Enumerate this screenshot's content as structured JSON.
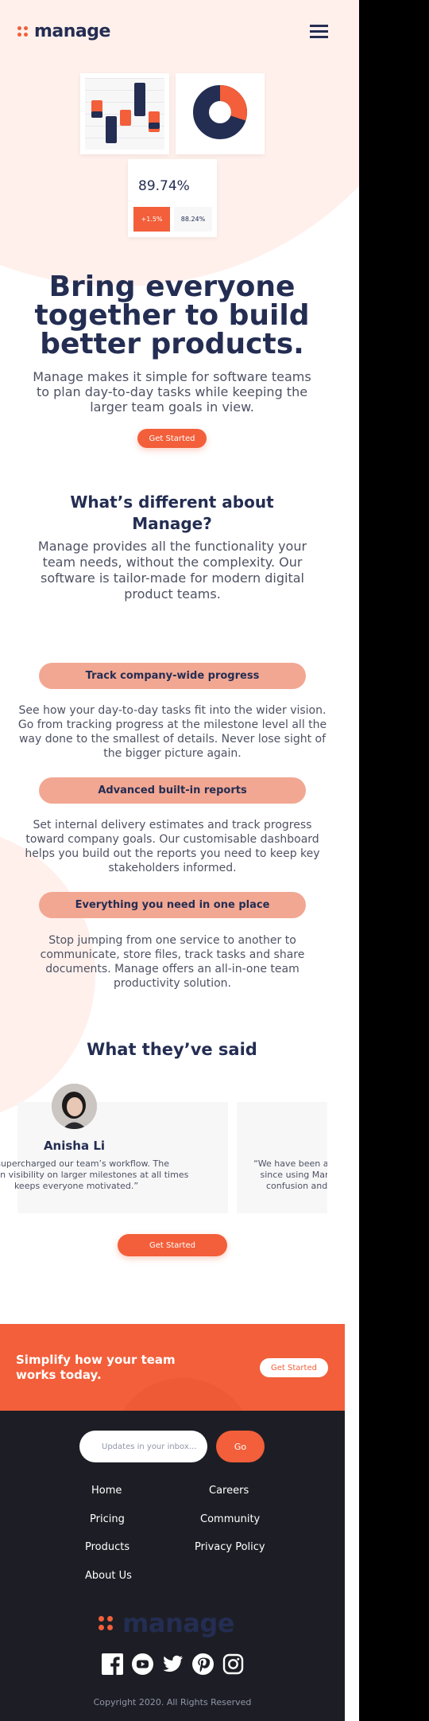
{
  "colors": {
    "accent": "#F25F3A",
    "navy": "#242D52",
    "pill": "#F2A793",
    "footer": "#1D1E25",
    "tint": "#FFF0EC"
  },
  "header": {
    "logo_text": "manage",
    "menu_icon": "hamburger-icon"
  },
  "illustration": {
    "bars": [
      {
        "color": "#F25F3A"
      },
      {
        "color": "#242D52"
      },
      {
        "color": "#F25F3A"
      },
      {
        "color": "#242D52"
      },
      {
        "color": "#F25F3A"
      }
    ],
    "donut": {
      "orange_fraction": 0.3
    },
    "stat_main": "89.74%",
    "stat_delta": "+1.5%",
    "stat_secondary": "88.24%"
  },
  "hero": {
    "title": "Bring everyone together to build better products.",
    "text": "Manage makes it simple for software teams to plan day-to-day tasks while keeping the larger team goals in view.",
    "cta_label": "Get Started"
  },
  "different": {
    "title": "What’s different about Manage?",
    "text": "Manage provides all the functionality your team needs, without the complexity. Our software is tailor-made for modern digital product teams."
  },
  "features": [
    {
      "title": "Track company-wide progress",
      "text": "See how your day-to-day tasks fit into the wider vision. Go from tracking progress at the milestone level all the way done to the smallest of details. Never lose sight of the bigger picture again."
    },
    {
      "title": "Advanced built-in reports",
      "text": "Set internal delivery estimates and track progress toward company goals. Our customisable dashboard helps you build out the reports you need to keep key stakeholders informed."
    },
    {
      "title": "Everything you need in one place",
      "text": "Stop jumping from one service to another to communicate, store files, track tasks and share documents. Manage offers an all-in-one team productivity solution."
    }
  ],
  "testimonials": {
    "title": "What they’ve said",
    "items": [
      {
        "name": "Anisha Li",
        "quote_lines": [
          "s supercharged our team’s workflow. The",
          "tain visibility on larger milestones at all times",
          "keeps everyone motivated.”"
        ]
      },
      {
        "quote_lines": [
          "“We have been able to",
          "since using Manage",
          "confusion and ev"
        ]
      }
    ],
    "cta_label": "Get Started"
  },
  "cta_band": {
    "text": "Simplify how your team works today.",
    "button_label": "Get Started"
  },
  "footer": {
    "input_placeholder": "Updates in your inbox…",
    "go_label": "Go",
    "links_left": [
      "Home",
      "Pricing",
      "Products",
      "About Us"
    ],
    "links_right": [
      "Careers",
      "Community",
      "Privacy Policy"
    ],
    "logo_text": "manage",
    "socials": [
      "facebook-icon",
      "youtube-icon",
      "twitter-icon",
      "pinterest-icon",
      "instagram-icon"
    ],
    "copyright": "Copyright 2020. All Rights Reserved"
  }
}
